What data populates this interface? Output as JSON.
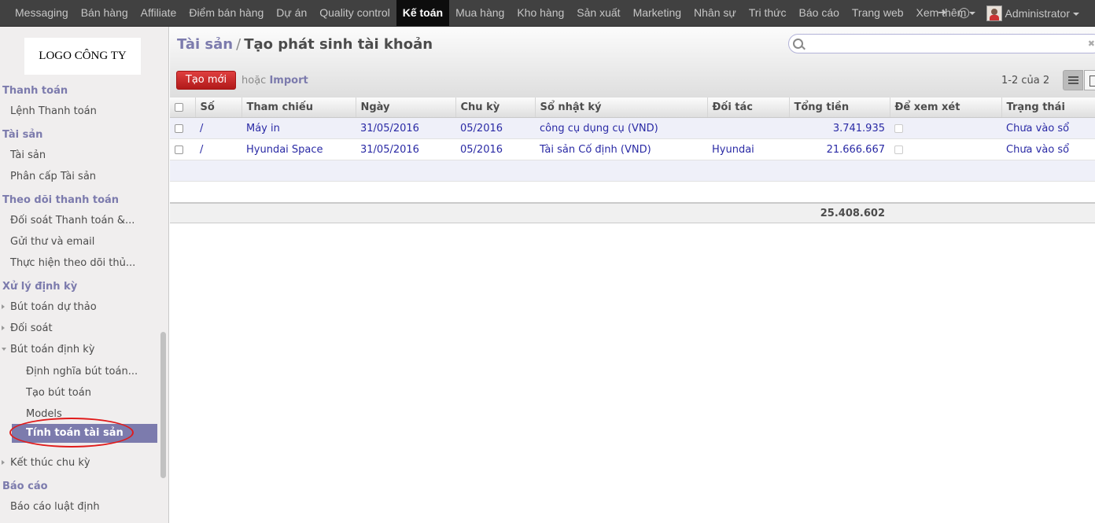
{
  "topbar": {
    "menu": [
      "Messaging",
      "Bán hàng",
      "Affiliate",
      "Điểm bán hàng",
      "Dự án",
      "Quality control",
      "Kế toán",
      "Mua hàng",
      "Kho hàng",
      "Sản xuất",
      "Marketing",
      "Nhân sự",
      "Tri thức",
      "Báo cáo",
      "Trang web",
      "Xem thêm"
    ],
    "user": "Administrator"
  },
  "sidebar": {
    "logo": "LOGO CÔNG TY",
    "sections": {
      "thanh_toan": "Thanh toán",
      "tai_san": "Tài sản",
      "theo_doi": "Theo dõi thanh toán",
      "xu_ly": "Xử lý định kỳ",
      "bao_cao": "Báo cáo"
    },
    "items": {
      "lenh_thanh_toan": "Lệnh Thanh toán",
      "tai_san": "Tài sản",
      "phan_cap": "Phân cấp Tài sản",
      "doi_soat_tt": "Đối soát Thanh toán &...",
      "gui_thu": "Gửi thư và email",
      "thuc_hien": "Thực hiện theo dõi thủ...",
      "but_toan_du_thao": "Bút toán dự thảo",
      "doi_soat": "Đối soát",
      "but_toan_dinh_ky": "Bút toán định kỳ",
      "dinh_nghia": "Định nghĩa bút toán...",
      "tao_but_toan": "Tạo bút toán",
      "models": "Models",
      "tinh_toan": "Tính toán tài sản",
      "ket_thuc": "Kết thúc chu kỳ",
      "bao_cao_luat": "Báo cáo luật định"
    }
  },
  "header": {
    "breadcrumb_link": "Tài sản",
    "breadcrumb_sep": "/",
    "breadcrumb_current": "Tạo phát sinh tài khoản",
    "create_label": "Tạo mới",
    "or_label": "hoặc",
    "import_label": "Import",
    "pager": "1-2 của 2"
  },
  "table": {
    "columns": [
      "Số",
      "Tham chiếu",
      "Ngày",
      "Chu kỳ",
      "Sổ nhật ký",
      "Đối tác",
      "Tổng tiền",
      "Để xem xét",
      "Trạng thái"
    ],
    "rows": [
      {
        "so": "/",
        "ref": "Máy in",
        "date": "31/05/2016",
        "period": "05/2016",
        "journal": "công cụ dụng cụ (VND)",
        "partner": "",
        "total": "3.741.935",
        "state": "Chưa vào sổ"
      },
      {
        "so": "/",
        "ref": "Hyundai Space",
        "date": "31/05/2016",
        "period": "05/2016",
        "journal": "Tài sản Cố định (VND)",
        "partner": "Hyundai",
        "total": "21.666.667",
        "state": "Chưa vào sổ"
      }
    ],
    "sum_total": "25.408.602"
  }
}
